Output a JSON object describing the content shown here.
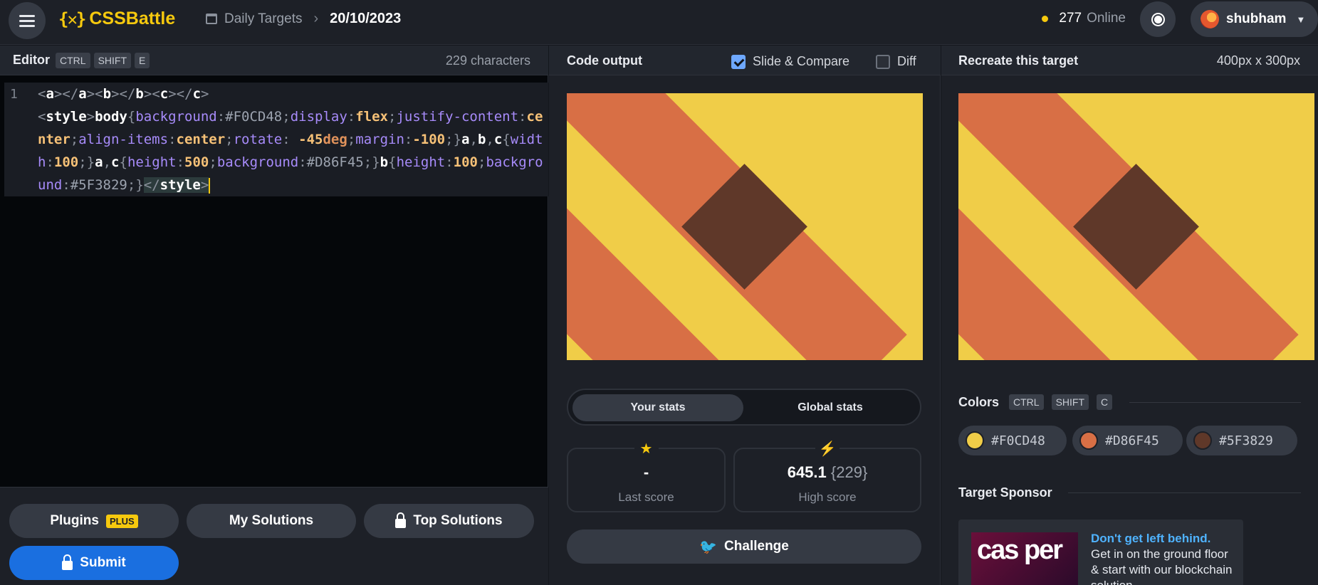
{
  "header": {
    "logo_mark": "{✕}",
    "logo_text": "CSSBattle",
    "breadcrumb_link": "Daily Targets",
    "breadcrumb_current": "20/10/2023",
    "online_count": "277",
    "online_label": "Online",
    "user_name": "shubham"
  },
  "editor": {
    "title": "Editor",
    "shortcut": [
      "CTRL",
      "SHIFT",
      "E"
    ],
    "char_count": "229 characters",
    "line_number": "1",
    "code": "<a></a><b></b><c></c>\n<style>body{background:#F0CD48;display:flex;justify-content:center;align-items:center;rotate: -45deg;margin:-100;}a,b,c{width:100;}a,c{height:500;background:#D86F45;}b{height:100;background:#5F3829;}</style>",
    "buttons": {
      "plugins": "Plugins",
      "plugins_badge": "PLUS",
      "my_solutions": "My Solutions",
      "top_solutions": "Top Solutions",
      "submit": "Submit"
    }
  },
  "output": {
    "title": "Code output",
    "slide_compare": "Slide & Compare",
    "slide_compare_checked": true,
    "diff": "Diff",
    "diff_checked": false,
    "tabs": [
      "Your stats",
      "Global stats"
    ],
    "last_score_value": "-",
    "last_score_label": "Last score",
    "high_score_value": "645.1",
    "high_score_chars": "{229}",
    "high_score_label": "High score",
    "challenge": "Challenge"
  },
  "target": {
    "title": "Recreate this target",
    "size": "400px x 300px",
    "colors_title": "Colors",
    "colors_shortcut": [
      "CTRL",
      "SHIFT",
      "C"
    ],
    "colors": [
      "#F0CD48",
      "#D86F45",
      "#5F3829"
    ],
    "sponsor_title": "Target Sponsor",
    "sponsor_logo": "cas per",
    "sponsor_headline": "Don't get left behind.",
    "sponsor_body": "Get in on the ground floor & start with our blockchain solution"
  },
  "colors": {
    "accent": "#f6c90e",
    "submit": "#1a6fe0",
    "art_bg": "#F0CD48",
    "art_stripe": "#D86F45",
    "art_square": "#5F3829"
  }
}
